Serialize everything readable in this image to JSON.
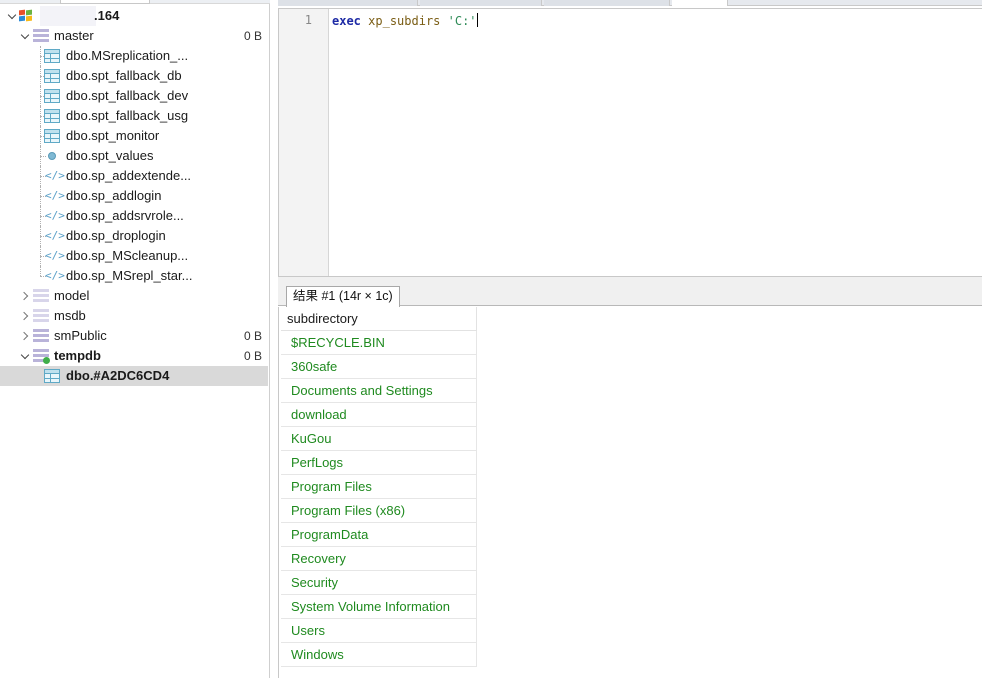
{
  "tree": {
    "server": {
      "label": ".164"
    },
    "databases": [
      {
        "key": "master",
        "label": "master",
        "size": "0 B"
      },
      {
        "key": "model",
        "label": "model",
        "size": ""
      },
      {
        "key": "msdb",
        "label": "msdb",
        "size": ""
      },
      {
        "key": "smPublic",
        "label": "smPublic",
        "size": "0 B"
      },
      {
        "key": "tempdb",
        "label": "tempdb",
        "size": "0 B"
      }
    ],
    "master_objects": [
      {
        "label": "dbo.MSreplication_...",
        "kind": "table"
      },
      {
        "label": "dbo.spt_fallback_db",
        "kind": "table"
      },
      {
        "label": "dbo.spt_fallback_dev",
        "kind": "table"
      },
      {
        "label": "dbo.spt_fallback_usg",
        "kind": "table"
      },
      {
        "label": "dbo.spt_monitor",
        "kind": "table"
      },
      {
        "label": "dbo.spt_values",
        "kind": "view"
      },
      {
        "label": "dbo.sp_addextende...",
        "kind": "procedure"
      },
      {
        "label": "dbo.sp_addlogin",
        "kind": "procedure"
      },
      {
        "label": "dbo.sp_addsrvrole...",
        "kind": "procedure"
      },
      {
        "label": "dbo.sp_droplogin",
        "kind": "procedure"
      },
      {
        "label": "dbo.sp_MScleanup...",
        "kind": "procedure"
      },
      {
        "label": "dbo.sp_MSrepl_star...",
        "kind": "procedure"
      }
    ],
    "tempdb_objects": [
      {
        "label": "dbo.#A2DC6CD4",
        "kind": "table"
      }
    ],
    "proc_icon": "</>"
  },
  "editor": {
    "line_number": "1",
    "code": {
      "keyword": "exec",
      "function": "xp_subdirs",
      "string": "'C:'"
    }
  },
  "results": {
    "tab_label": "结果 #1 (14r × 1c)",
    "column": "subdirectory",
    "rows": [
      "$RECYCLE.BIN",
      "360safe",
      "Documents and Settings",
      "download",
      "KuGou",
      "PerfLogs",
      "Program Files",
      "Program Files (x86)",
      "ProgramData",
      "Recovery",
      "Security",
      "System Volume Information",
      "Users",
      "Windows"
    ]
  },
  "colors": {
    "result_text": "#1f8a1f",
    "selection": "#d9d9d9",
    "keyword": "#1d2aa5",
    "string": "#2e8b57"
  }
}
